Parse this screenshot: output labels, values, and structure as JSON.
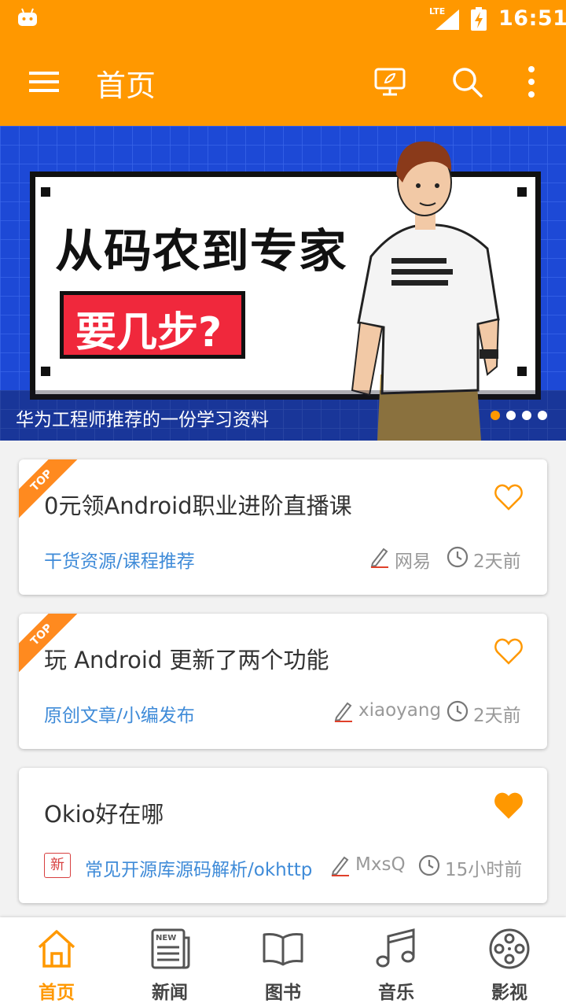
{
  "status_bar": {
    "time": "16:51",
    "network": "LTE"
  },
  "toolbar": {
    "title": "首页"
  },
  "banner": {
    "headline": "从码农到专家",
    "subheadline": "要几步?",
    "caption": "华为工程师推荐的一份学习资料",
    "page_count": 4,
    "active_page": 1
  },
  "articles": [
    {
      "badge": "TOP",
      "title": "0元领Android职业进阶直播课",
      "chapter": "干货资源/课程推荐",
      "author": "网易",
      "time": "2天前",
      "favorited": false
    },
    {
      "badge": "TOP",
      "title": "玩 Android 更新了两个功能",
      "chapter": "原创文章/小编发布",
      "author": "xiaoyang",
      "time": "2天前",
      "favorited": false
    },
    {
      "tag": "新",
      "title": "Okio好在哪",
      "chapter": "常见开源库源码解析/okhttp",
      "author": "MxsQ",
      "time": "15小时前",
      "favorited": true
    }
  ],
  "bottom_nav": [
    {
      "label": "首页",
      "icon": "home-icon",
      "active": true
    },
    {
      "label": "新闻",
      "icon": "news-icon",
      "active": false
    },
    {
      "label": "图书",
      "icon": "book-icon",
      "active": false
    },
    {
      "label": "音乐",
      "icon": "music-icon",
      "active": false
    },
    {
      "label": "影视",
      "icon": "film-icon",
      "active": false
    }
  ],
  "colors": {
    "accent": "#ff9800",
    "link": "#3f8bd8",
    "meta": "#999999",
    "banner_bg": "#1d49d6"
  }
}
